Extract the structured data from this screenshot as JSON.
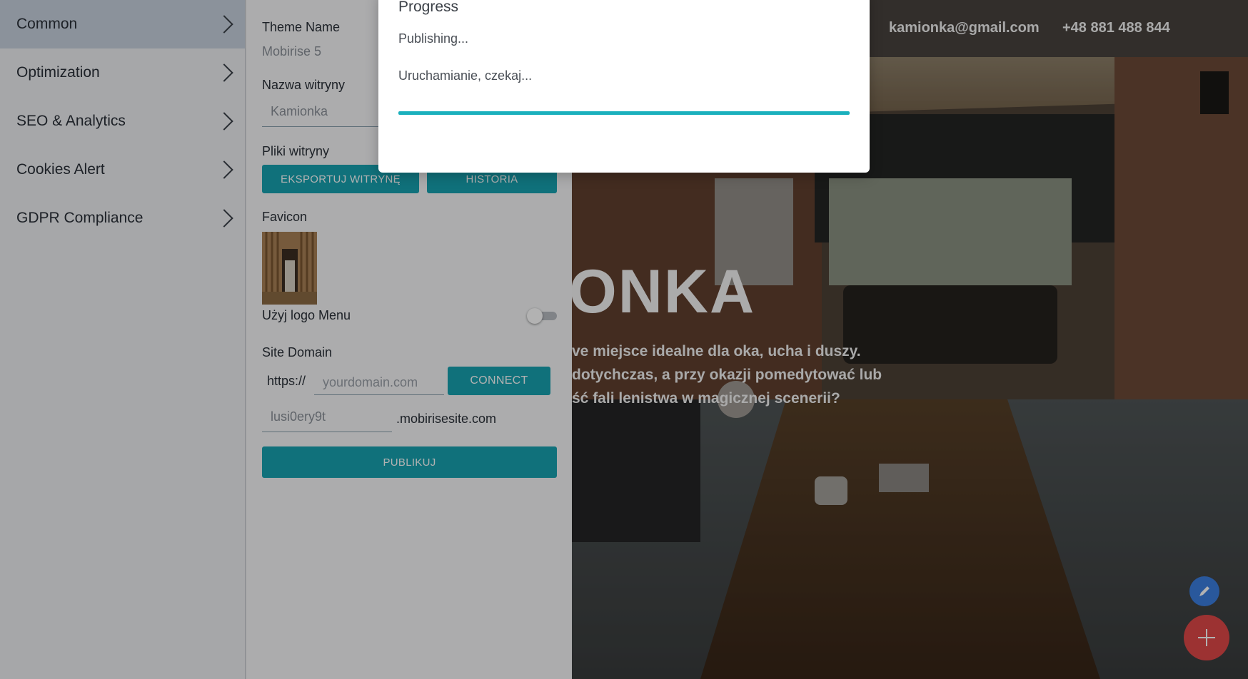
{
  "sidebar": {
    "items": [
      {
        "label": "Common"
      },
      {
        "label": "Optimization"
      },
      {
        "label": "SEO & Analytics"
      },
      {
        "label": "Cookies Alert"
      },
      {
        "label": "GDPR Compliance"
      }
    ]
  },
  "panel": {
    "theme_name_label": "Theme Name",
    "theme_name_value": "Mobirise 5",
    "site_name_label": "Nazwa witryny",
    "site_name_value": "Kamionka",
    "site_files_label": "Pliki witryny",
    "export_button": "EKSPORTUJ WITRYNĘ",
    "history_button": "HISTORIA",
    "favicon_label": "Favicon",
    "use_logo_label": "Użyj logo Menu",
    "site_domain_label": "Site Domain",
    "domain_prefix": "https://",
    "domain_placeholder": "yourdomain.com",
    "connect_button": "CONNECT",
    "subdomain_value": "lusi0ery9t",
    "subdomain_suffix": ".mobirisesite.com",
    "publish_button": "PUBLIKUJ"
  },
  "preview": {
    "email": "kamionka@gmail.com",
    "phone": "+48 881 488 844",
    "hero_title": "IONKA",
    "hero_lines": [
      "ve miejsce idealne dla oka, ucha i duszy.",
      "dotychczas, a przy okazji pomedytować lub",
      "ść fali lenistwa w magicznej scenerii?"
    ]
  },
  "modal": {
    "title": "Progress",
    "status_line": "Publishing...",
    "wait_line": "Uruchamianie, czekaj...",
    "progress": 1.0
  },
  "colors": {
    "accent": "#17a2b0",
    "fab_edit": "#3b7ee0",
    "fab_add": "#e04848"
  }
}
